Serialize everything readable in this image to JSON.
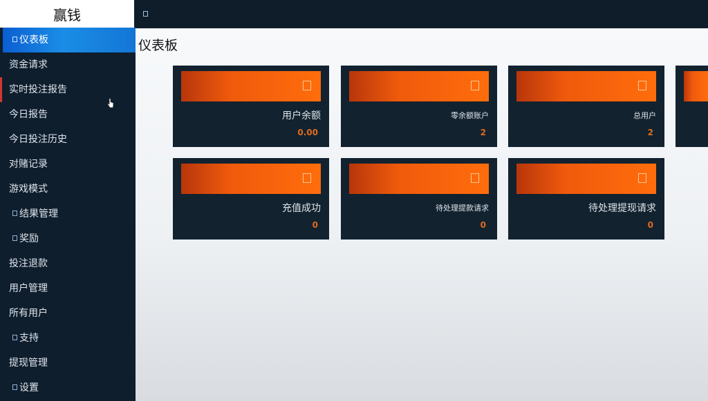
{
  "brand": "赢钱",
  "page_title": "仪表板",
  "sidebar": {
    "items": [
      {
        "label": "仪表板"
      },
      {
        "label": "资金请求"
      },
      {
        "label": "实时投注报告"
      },
      {
        "label": "今日报告"
      },
      {
        "label": "今日投注历史"
      },
      {
        "label": "对赌记录"
      },
      {
        "label": "游戏模式"
      },
      {
        "label": "结果管理"
      },
      {
        "label": "奖励"
      },
      {
        "label": "投注退款"
      },
      {
        "label": "用户管理"
      },
      {
        "label": "所有用户"
      },
      {
        "label": "支持"
      },
      {
        "label": "提现管理"
      },
      {
        "label": "设置"
      }
    ]
  },
  "cards": [
    {
      "label": "用户余额",
      "value": "0.00"
    },
    {
      "label": "零余额账户",
      "value": "2"
    },
    {
      "label": "总用户",
      "value": "2"
    },
    {
      "label": "充值成功",
      "value": "0"
    },
    {
      "label": "待处理提款请求",
      "value": "0"
    },
    {
      "label": "待处理提现请求",
      "value": "0"
    }
  ],
  "colors": {
    "sidebar_bg": "#0f1e2d",
    "active_nav": "#1a8de6",
    "card_bg": "#12222f",
    "card_accent": "#ff6d0c",
    "value_color": "#e06a1e"
  }
}
